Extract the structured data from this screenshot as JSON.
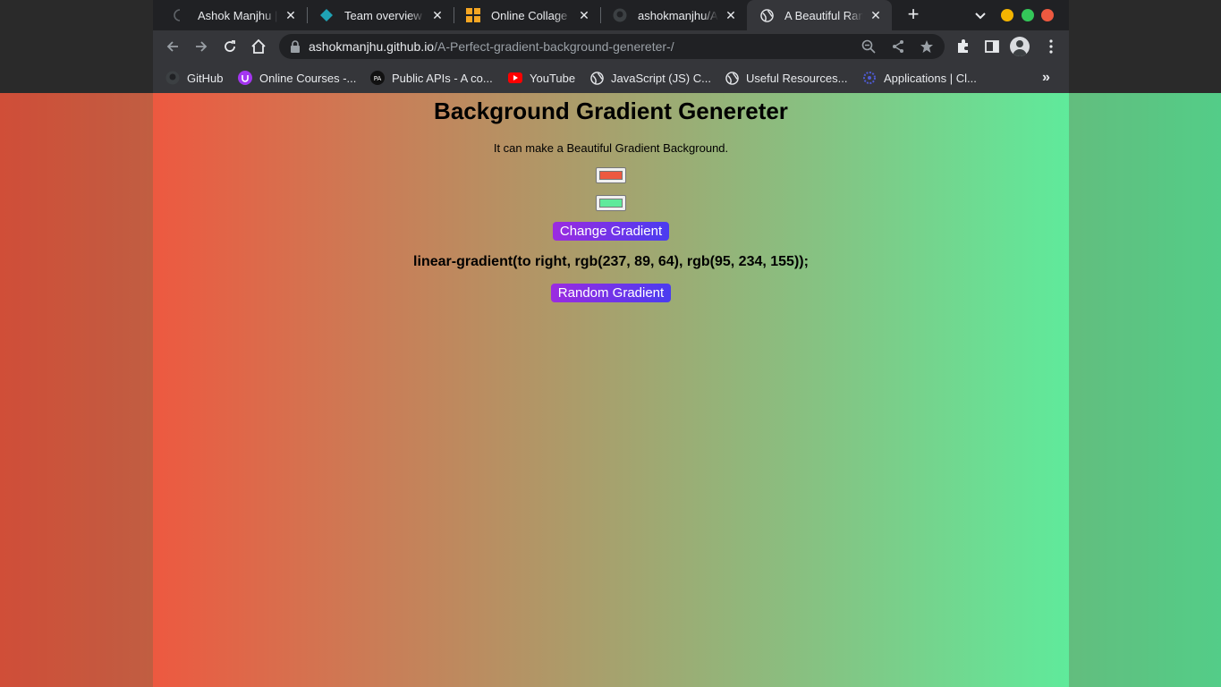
{
  "browser": {
    "tabs": [
      {
        "title": "Ashok Manjhu | D",
        "favicon": "loading-spinner-icon"
      },
      {
        "title": "Team overview | t",
        "favicon": "diamond-icon"
      },
      {
        "title": "Online Collage M",
        "favicon": "collage-grid-icon"
      },
      {
        "title": "ashokmanjhu/A-P",
        "favicon": "github-icon"
      },
      {
        "title": "A Beautiful Rand",
        "favicon": "globe-icon",
        "active": true
      }
    ],
    "url_host": "ashokmanjhu.github.io",
    "url_path": "/A-Perfect-gradient-background-genereter-/",
    "bookmarks": [
      {
        "label": "GitHub",
        "icon": "github-icon"
      },
      {
        "label": "Online Courses -...",
        "icon": "udemy-icon"
      },
      {
        "label": "Public APIs - A co...",
        "icon": "public-apis-icon"
      },
      {
        "label": "YouTube",
        "icon": "youtube-icon"
      },
      {
        "label": "JavaScript (JS) C...",
        "icon": "globe-icon"
      },
      {
        "label": "Useful Resources...",
        "icon": "globe-icon"
      },
      {
        "label": "Applications | Cl...",
        "icon": "apps-icon"
      }
    ],
    "colors": {
      "chrome_dark": "#202124",
      "chrome_toolbar": "#35363a",
      "minimize": "#f4b400",
      "maximize": "#34c759",
      "close": "#ed5940"
    }
  },
  "page": {
    "title": "Background Gradient Genereter",
    "subtitle": "It can make a Beautiful Gradient Background.",
    "color1": "#ed5940",
    "color2": "#5fea9b",
    "change_button": "Change Gradient",
    "css_output": "linear-gradient(to right, rgb(237, 89, 64), rgb(95, 234, 155));",
    "random_button": "Random Gradient"
  }
}
